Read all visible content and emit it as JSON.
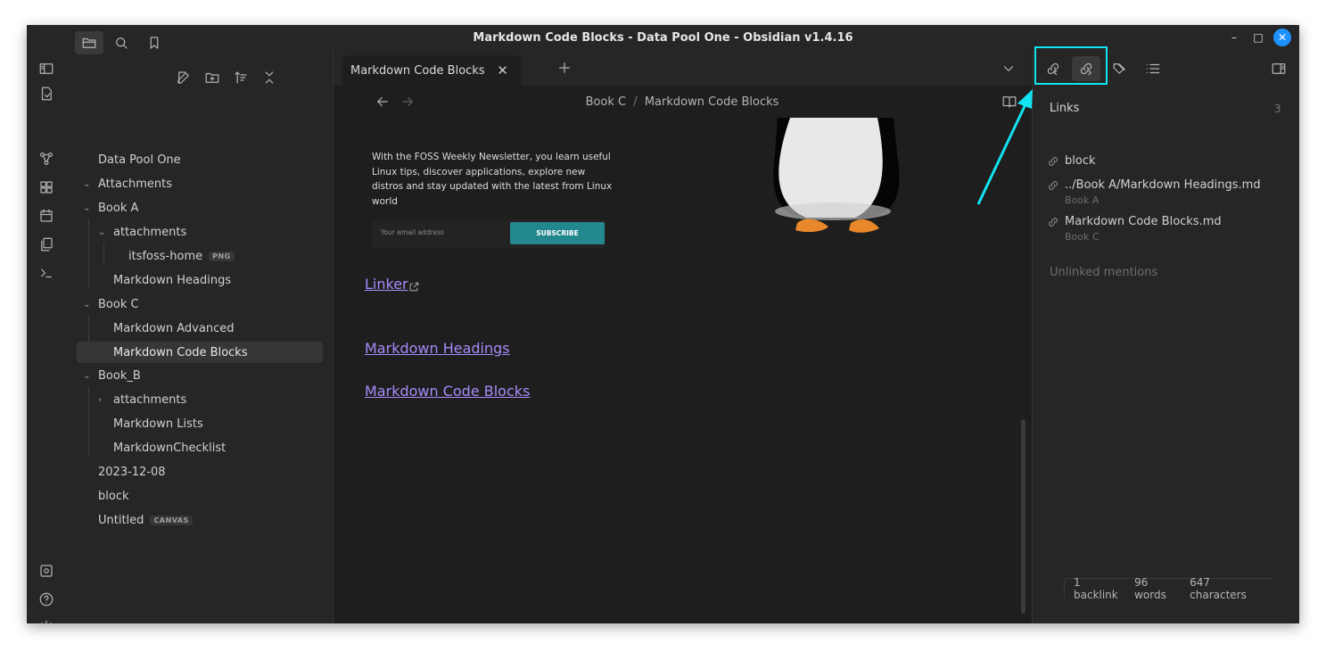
{
  "window": {
    "title": "Markdown Code Blocks - Data Pool One - Obsidian v1.4.16"
  },
  "file_explorer": {
    "vault": "Data Pool One",
    "items": [
      {
        "label": "Attachments"
      },
      {
        "label": "Book A"
      },
      {
        "label": "attachments"
      },
      {
        "label": "itsfoss-home",
        "badge": "PNG"
      },
      {
        "label": "Markdown Headings"
      },
      {
        "label": "Book C"
      },
      {
        "label": "Markdown Advanced"
      },
      {
        "label": "Markdown Code Blocks"
      },
      {
        "label": "Book_B"
      },
      {
        "label": "attachments"
      },
      {
        "label": "Markdown Lists"
      },
      {
        "label": "MarkdownChecklist"
      },
      {
        "label": "2023-12-08"
      },
      {
        "label": "block"
      },
      {
        "label": "Untitled",
        "badge": "CANVAS"
      }
    ]
  },
  "tab": {
    "label": "Markdown Code Blocks"
  },
  "breadcrumb": {
    "parent": "Book C",
    "separator": "/",
    "current": "Markdown Code Blocks"
  },
  "note": {
    "newsletter_text": "With the FOSS Weekly Newsletter, you learn useful Linux tips, discover applications, explore new distros and stay updated with the latest from Linux world",
    "email_placeholder": "Your email address",
    "subscribe_label": "SUBSCRIBE",
    "links": [
      "Linker",
      "Markdown Headings",
      "Markdown Code Blocks"
    ]
  },
  "links_panel": {
    "heading": "Links",
    "count": "3",
    "items": [
      {
        "name": "block",
        "sub": ""
      },
      {
        "name": "../Book A/Markdown Headings.md",
        "sub": "Book A"
      },
      {
        "name": "Markdown Code Blocks.md",
        "sub": "Book C"
      }
    ],
    "unlinked": "Unlinked mentions"
  },
  "status": {
    "backlinks": "1 backlink",
    "words": "96 words",
    "chars": "647 characters"
  },
  "colors": {
    "accent_link": "#a78bfa",
    "highlight": "#12e3f0",
    "subscribe": "#23878e"
  },
  "icons": [
    "sidebar-toggle-icon",
    "folder-icon",
    "search-icon",
    "bookmark-icon",
    "plus-icon",
    "chevron-down-icon",
    "backlinks-icon",
    "outgoing-links-icon",
    "tags-icon",
    "outline-icon",
    "right-sidebar-icon",
    "settings-icon",
    "help-icon",
    "vault-icon"
  ]
}
